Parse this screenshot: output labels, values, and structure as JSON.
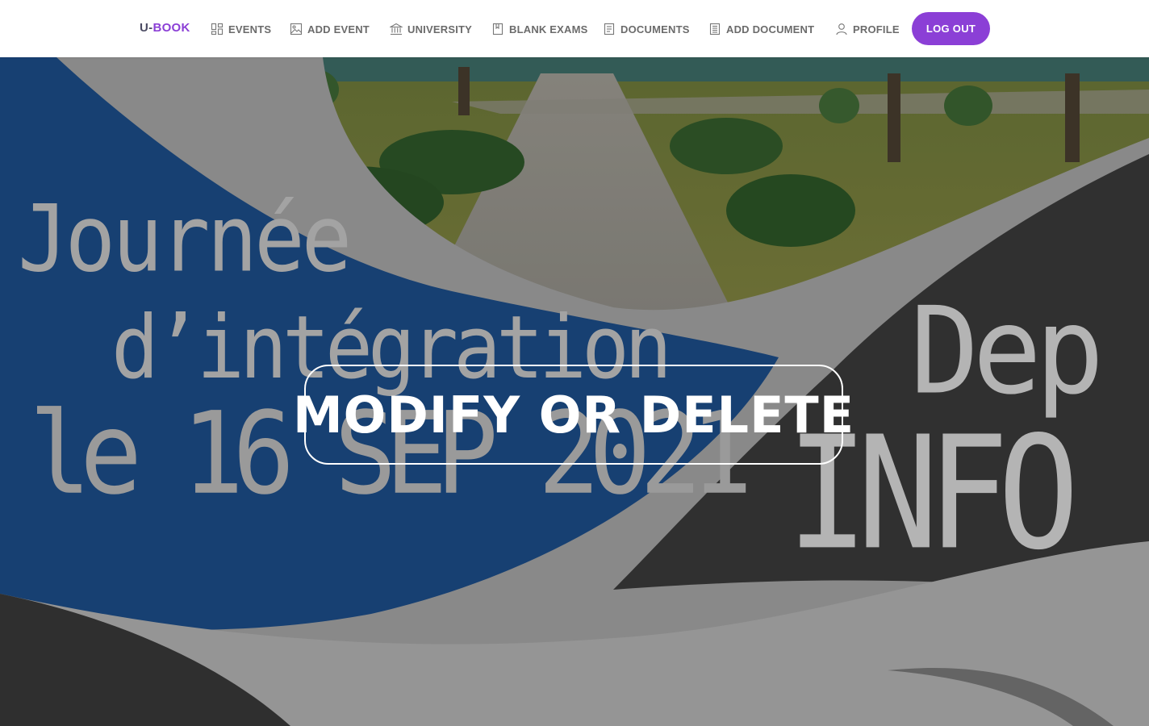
{
  "brand": {
    "prefix": "U-",
    "name": "BOOK",
    "accent_color": "#8b3fd6"
  },
  "nav": [
    {
      "label": "EVENTS",
      "icon": "grid-icon"
    },
    {
      "label": "ADD EVENT",
      "icon": "image-icon"
    },
    {
      "label": "UNIVERSITY",
      "icon": "bank-icon"
    },
    {
      "label": "BLANK EXAMS",
      "icon": "bookmark-book-icon"
    },
    {
      "label": "DOCUMENTS",
      "icon": "document-icon"
    },
    {
      "label": "ADD DOCUMENT",
      "icon": "document-lines-icon"
    },
    {
      "label": "PROFILE",
      "icon": "user-icon"
    }
  ],
  "logout": {
    "label": "LOG OUT"
  },
  "hero": {
    "button_label": "MODIFY OR DELETE",
    "poster": {
      "line1": "Journée",
      "line2": "d’intégration",
      "line3": "le 16 SEP 2021",
      "dep": "Dep",
      "info": "INFO"
    },
    "colors": {
      "blue": "#1a4f94",
      "dark": "#3a3a3a",
      "light": "#b9b9b9",
      "grass": "#7d8a3c"
    }
  }
}
